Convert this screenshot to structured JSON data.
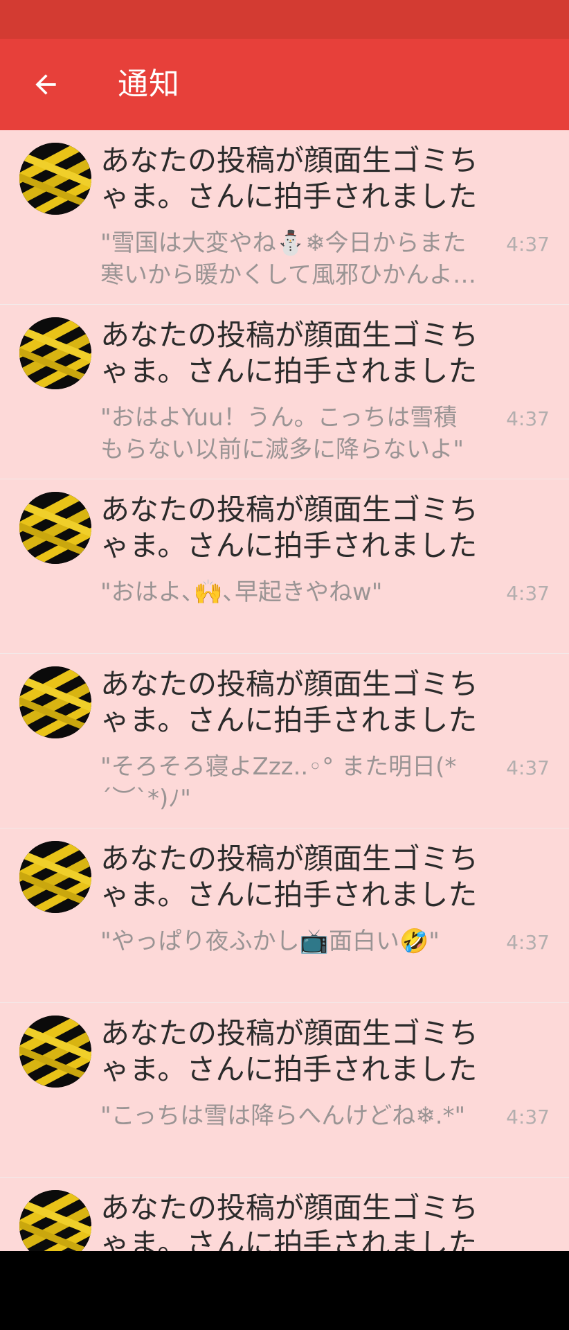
{
  "app_bar": {
    "title": "通知",
    "back_icon": "arrow-left-icon"
  },
  "notifications": [
    {
      "title": "あなたの投稿が顔面生ゴミちゃま。さんに拍手されました",
      "body": "\"雪国は大変やね⛄❄今日からまた寒いから暖かくして風邪ひかんようにね\"",
      "time": "4:37",
      "avatar_icon": "warning-tape-avatar"
    },
    {
      "title": "あなたの投稿が顔面生ゴミちゃま。さんに拍手されました",
      "body": "\"おはよYuu！うん。こっちは雪積もらない以前に滅多に降らないよ\"",
      "time": "4:37",
      "avatar_icon": "warning-tape-avatar"
    },
    {
      "title": "あなたの投稿が顔面生ゴミちゃま。さんに拍手されました",
      "body": "\"おはよ､🙌､早起きやねw\"",
      "time": "4:37",
      "avatar_icon": "warning-tape-avatar"
    },
    {
      "title": "あなたの投稿が顔面生ゴミちゃま。さんに拍手されました",
      "body": "\"そろそろ寝よZzz..◦° また明日(*´︶`*)ﾉ\"",
      "time": "4:37",
      "avatar_icon": "warning-tape-avatar"
    },
    {
      "title": "あなたの投稿が顔面生ゴミちゃま。さんに拍手されました",
      "body": "\"やっぱり夜ふかし📺面白い🤣\"",
      "time": "4:37",
      "avatar_icon": "warning-tape-avatar"
    },
    {
      "title": "あなたの投稿が顔面生ゴミちゃま。さんに拍手されました",
      "body": "\"こっちは雪は降らへんけどね❄.*\"",
      "time": "4:37",
      "avatar_icon": "warning-tape-avatar"
    },
    {
      "title": "あなたの投稿が顔面生ゴミちゃま。さんに拍手されました",
      "body": "",
      "time": "",
      "avatar_icon": "warning-tape-avatar"
    }
  ],
  "colors": {
    "status_bar": "#d33b32",
    "app_bar": "#e7403a",
    "list_background": "#fdd9d8"
  }
}
